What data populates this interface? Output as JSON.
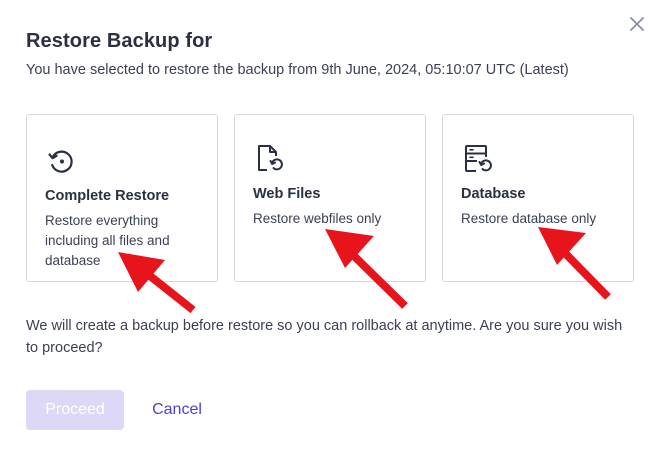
{
  "dialog": {
    "title": "Restore Backup for",
    "subtitle": "You have selected to restore the backup from 9th June, 2024, 05:10:07 UTC (Latest)",
    "close_icon": "close-icon"
  },
  "options": [
    {
      "icon": "restore-history-icon",
      "title": "Complete Restore",
      "description": "Restore everything including all files and database"
    },
    {
      "icon": "file-restore-icon",
      "title": "Web Files",
      "description": "Restore webfiles only"
    },
    {
      "icon": "database-restore-icon",
      "title": "Database",
      "description": "Restore database only"
    }
  ],
  "note": "We will create a backup before restore so you can rollback at anytime. Are you sure you wish to proceed?",
  "actions": {
    "proceed_label": "Proceed",
    "cancel_label": "Cancel"
  },
  "colors": {
    "text_dark": "#2b2f44",
    "accent": "#4a3fd6",
    "proceed_disabled_bg": "#dcd8f6",
    "annotation_arrow": "#e8141b"
  }
}
